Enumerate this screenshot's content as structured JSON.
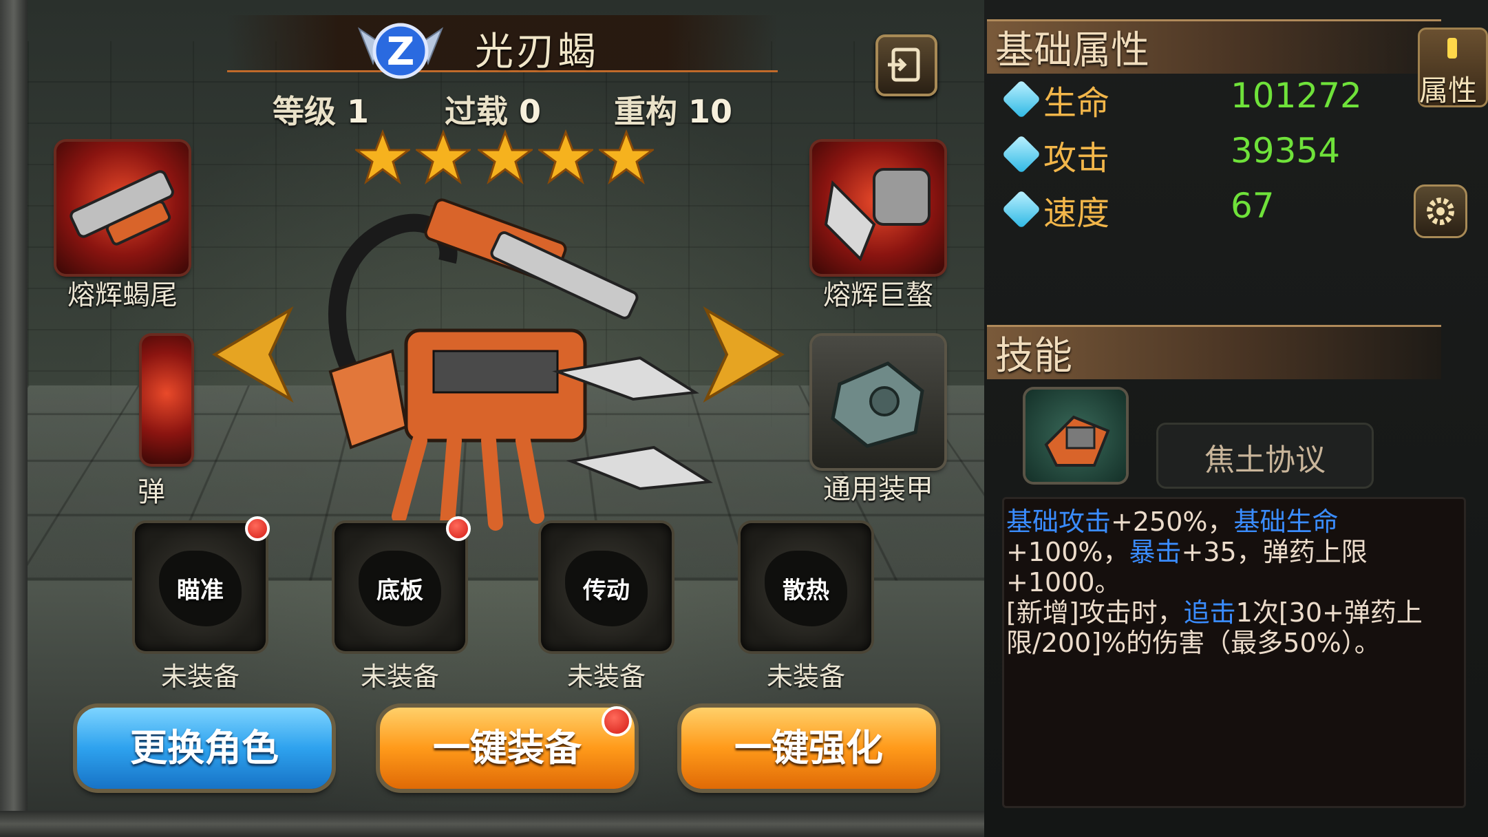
{
  "character": {
    "name": "光刃蝎",
    "level_label": "等级",
    "level": "1",
    "overload_label": "过载",
    "overload": "0",
    "rebuild_label": "重构",
    "rebuild": "10",
    "stars": 5,
    "rank_badge": "Z"
  },
  "equipment": {
    "tail": "熔辉蝎尾",
    "claw": "熔辉巨螯",
    "armor": "通用装甲",
    "partial_left": "弹"
  },
  "modules": [
    {
      "name": "瞄准",
      "status": "未装备",
      "has_alert": true
    },
    {
      "name": "底板",
      "status": "未装备",
      "has_alert": true
    },
    {
      "name": "传动",
      "status": "未装备",
      "has_alert": false
    },
    {
      "name": "散热",
      "status": "未装备",
      "has_alert": false
    }
  ],
  "buttons": {
    "change_character": "更换角色",
    "auto_equip": "一键装备",
    "auto_enhance": "一键强化"
  },
  "attributes": {
    "header": "基础属性",
    "tab_label": "属性",
    "items": [
      {
        "name": "生命",
        "value": "101272"
      },
      {
        "name": "攻击",
        "value": "39354"
      },
      {
        "name": "速度",
        "value": "67"
      }
    ]
  },
  "skill": {
    "header": "技能",
    "name": "焦土协议",
    "desc": {
      "p1": "基础攻击",
      "p2": "+250%，",
      "p3": "基础生命",
      "p4": "+100%，",
      "p5": "暴击",
      "p6": "+35，弹药上限+1000。",
      "p7": "[新增]攻击时，",
      "p8": "追击",
      "p9": "1次[30+弹药上限/200]%的伤害（最多50%）。"
    }
  },
  "colors": {
    "attr_name": "#f2b64a",
    "attr_value": "#6fe23a",
    "highlight": "#3a8cff",
    "orange_button": "#ff9a1a",
    "blue_button": "#2ea2ee"
  }
}
